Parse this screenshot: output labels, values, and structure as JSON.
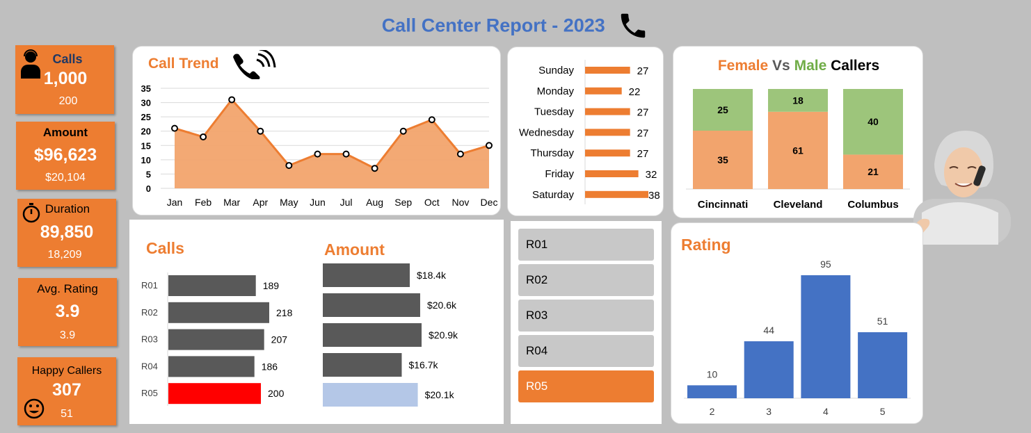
{
  "title": "Call Center Report - 2023",
  "colors": {
    "orange": "#ed7d31",
    "blue": "#4472c4",
    "green": "#9dc57b",
    "peach": "#f2a46d",
    "dark_gray": "#595959",
    "red": "#ff0000",
    "light_blue": "#b4c7e7"
  },
  "kpis": {
    "calls": {
      "label": "Calls",
      "value": "1,000",
      "sub": "200"
    },
    "amount": {
      "label": "Amount",
      "value": "$96,623",
      "sub": "$20,104"
    },
    "duration": {
      "label": "Duration",
      "value": "89,850",
      "sub": "18,209"
    },
    "rating": {
      "label": "Avg. Rating",
      "value": "3.9",
      "sub": "3.9"
    },
    "happy": {
      "label": "Happy Callers",
      "value": "307",
      "sub": "51"
    }
  },
  "call_trend": {
    "title": "Call Trend"
  },
  "gender": {
    "female": "Female",
    "vs": "Vs",
    "male": "Male",
    "callers": "Callers"
  },
  "calls_panel": {
    "title": "Calls"
  },
  "amount_panel": {
    "title": "Amount"
  },
  "rating_panel": {
    "title": "Rating"
  },
  "slicer": {
    "items": [
      {
        "label": "R01",
        "selected": false
      },
      {
        "label": "R02",
        "selected": false
      },
      {
        "label": "R03",
        "selected": false
      },
      {
        "label": "R04",
        "selected": false
      },
      {
        "label": "R05",
        "selected": true
      }
    ]
  },
  "chart_data": [
    {
      "id": "call_trend",
      "type": "area",
      "categories": [
        "Jan",
        "Feb",
        "Mar",
        "Apr",
        "May",
        "Jun",
        "Jul",
        "Aug",
        "Sep",
        "Oct",
        "Nov",
        "Dec"
      ],
      "values": [
        21,
        18,
        31,
        20,
        8,
        12,
        12,
        7,
        20,
        24,
        12,
        15
      ],
      "yticks": [
        "0",
        "5",
        "10",
        "15",
        "20",
        "25",
        "30",
        "35"
      ],
      "ylim": [
        0,
        35
      ],
      "grid": true
    },
    {
      "id": "weekday",
      "type": "bar",
      "orientation": "horizontal",
      "categories": [
        "Sunday",
        "Monday",
        "Tuesday",
        "Wednesday",
        "Thursday",
        "Friday",
        "Saturday"
      ],
      "values": [
        27,
        22,
        27,
        27,
        27,
        32,
        38
      ],
      "labels": [
        "27",
        "22",
        "27",
        "27",
        "27",
        "32",
        "38"
      ]
    },
    {
      "id": "gender",
      "type": "bar",
      "stacked": true,
      "categories": [
        "Cincinnati",
        "Cleveland",
        "Columbus"
      ],
      "series": [
        {
          "name": "Female",
          "values": [
            35,
            61,
            21
          ],
          "labels": [
            "35",
            "61",
            "21"
          ]
        },
        {
          "name": "Male",
          "values": [
            25,
            18,
            40
          ],
          "labels": [
            "25",
            "18",
            "40"
          ]
        }
      ]
    },
    {
      "id": "calls_by_rep",
      "type": "bar",
      "orientation": "horizontal",
      "categories": [
        "R01",
        "R02",
        "R03",
        "R04",
        "R05"
      ],
      "values": [
        189,
        218,
        207,
        186,
        200
      ],
      "labels": [
        "189",
        "218",
        "207",
        "186",
        "200"
      ],
      "highlight": "R05"
    },
    {
      "id": "amount_by_rep",
      "type": "bar",
      "orientation": "horizontal",
      "categories": [
        "R01",
        "R02",
        "R03",
        "R04",
        "R05"
      ],
      "values": [
        18.4,
        20.6,
        20.9,
        16.7,
        20.1
      ],
      "labels": [
        "$18.4k",
        "$20.6k",
        "$20.9k",
        "$16.7k",
        "$20.1k"
      ],
      "highlight": "R05"
    },
    {
      "id": "rating",
      "type": "bar",
      "categories": [
        "2",
        "3",
        "4",
        "5"
      ],
      "values": [
        10,
        44,
        95,
        51
      ],
      "labels": [
        "10",
        "44",
        "95",
        "51"
      ]
    }
  ]
}
